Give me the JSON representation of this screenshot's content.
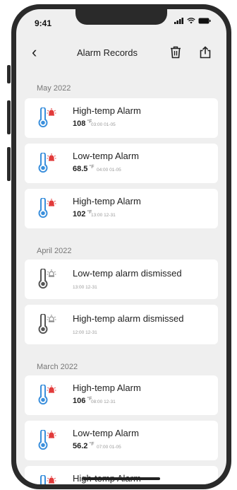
{
  "status": {
    "time": "9:41"
  },
  "header": {
    "title": "Alarm Records"
  },
  "colors": {
    "alert": "#e23b3b",
    "thermo": "#3a8fdc",
    "dismissed": "#555555"
  },
  "groups": [
    {
      "label": "May 2022",
      "items": [
        {
          "title": "High-temp Alarm",
          "value": "108",
          "unit": "°F",
          "time": "03:00 01-05",
          "icon": "thermometer-alert-icon"
        },
        {
          "title": "Low-temp Alarm",
          "value": "68.5",
          "unit": "°F",
          "time": "04:00 01-05",
          "icon": "thermometer-alert-icon"
        },
        {
          "title": "High-temp Alarm",
          "value": "102",
          "unit": "°F",
          "time": "13:00 12-31",
          "icon": "thermometer-alert-icon"
        }
      ]
    },
    {
      "label": "April 2022",
      "items": [
        {
          "title": "Low-temp alarm dismissed",
          "time": "13:00 12-31",
          "icon": "thermometer-dismissed-icon"
        },
        {
          "title": "High-temp alarm dismissed",
          "time": "12:00 12-31",
          "icon": "thermometer-dismissed-icon"
        }
      ]
    },
    {
      "label": "March 2022",
      "items": [
        {
          "title": "High-temp Alarm",
          "value": "106",
          "unit": "°F",
          "time": "08:00 12-31",
          "icon": "thermometer-alert-icon"
        },
        {
          "title": "Low-temp Alarm",
          "value": "56.2",
          "unit": "°F",
          "time": "07:00 01-05",
          "icon": "thermometer-alert-icon"
        },
        {
          "title": "High-temp Alarm",
          "icon": "thermometer-alert-icon"
        }
      ]
    }
  ]
}
